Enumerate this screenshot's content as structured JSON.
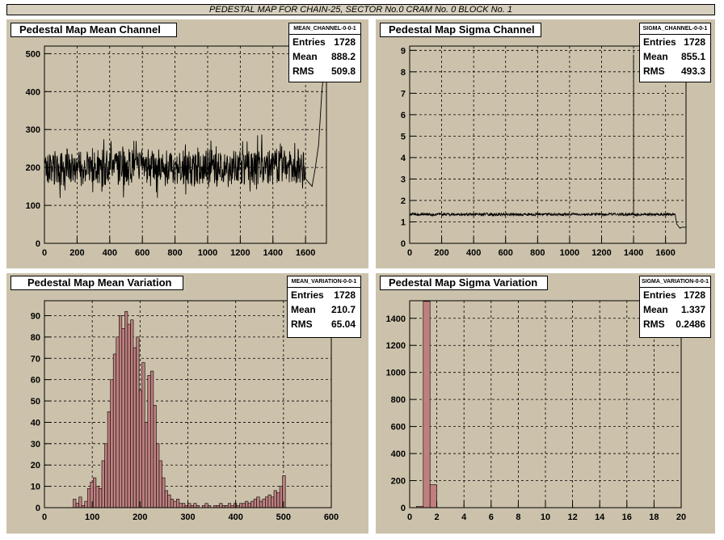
{
  "header": {
    "title": "PEDESTAL MAP FOR CHAIN-25, SECTOR No.0 CRAM No. 0 BLOCK No. 1"
  },
  "colors": {
    "panel_bg": "#ccc2ab",
    "hist_fill": "#bf7f7f",
    "frame": "#000000"
  },
  "chart_data": [
    {
      "type": "line",
      "title": "Pedestal Map Mean Channel",
      "xlim": [
        0,
        1728
      ],
      "ylim": [
        0,
        520
      ],
      "xticks": [
        0,
        200,
        400,
        600,
        800,
        1000,
        1200,
        1400,
        1600
      ],
      "yticks": [
        0,
        100,
        200,
        300,
        400,
        500
      ],
      "grid": true,
      "stats": {
        "name": "MEAN_CHANNEL-0-0-1",
        "entries": "1728",
        "mean": "888.2",
        "rms": "509.8"
      },
      "series": [
        {
          "baseline": 200,
          "noise": 45,
          "x": [
            1600,
            1640,
            1660,
            1680,
            1700,
            1728
          ],
          "y": [
            170,
            150,
            200,
            260,
            400,
            520
          ]
        }
      ]
    },
    {
      "type": "line",
      "title": "Pedestal Map Sigma Channel",
      "xlim": [
        0,
        1728
      ],
      "ylim": [
        0,
        9.2
      ],
      "xticks": [
        0,
        200,
        400,
        600,
        800,
        1000,
        1200,
        1400,
        1600
      ],
      "yticks": [
        0,
        1,
        2,
        3,
        4,
        5,
        6,
        7,
        8,
        9
      ],
      "grid": true,
      "stats": {
        "name": "SIGMA_CHANNEL-0-0-1",
        "entries": "1728",
        "mean": "855.1",
        "rms": "493.3"
      },
      "series": [
        {
          "baseline": 1.35,
          "noise": 0.06,
          "spike": {
            "x": 1400,
            "y": 8.8
          },
          "x": [
            1660,
            1670,
            1690,
            1700,
            1728
          ],
          "y": [
            1.35,
            0.9,
            0.7,
            0.75,
            0.75
          ]
        }
      ]
    },
    {
      "type": "bar",
      "title": "Pedestal Map Mean Variation",
      "xlim": [
        0,
        600
      ],
      "ylim": [
        0,
        97
      ],
      "xticks": [
        0,
        100,
        200,
        300,
        400,
        500,
        600
      ],
      "yticks": [
        0,
        10,
        20,
        30,
        40,
        50,
        60,
        70,
        80,
        90
      ],
      "grid": true,
      "bin_width": 6,
      "stats": {
        "name": "MEAN_VARIATION-0-0-1",
        "entries": "1728",
        "mean": "210.7",
        "rms": "65.04"
      },
      "bins_start": [
        60,
        66,
        72,
        78,
        84,
        90,
        96,
        102,
        108,
        114,
        120,
        126,
        132,
        138,
        144,
        150,
        156,
        162,
        168,
        174,
        180,
        186,
        192,
        198,
        204,
        210,
        216,
        222,
        228,
        234,
        240,
        246,
        252,
        258,
        264,
        270,
        276,
        282,
        288,
        294,
        300,
        306,
        312,
        318,
        324,
        330,
        336,
        342,
        348,
        354,
        360,
        366,
        372,
        378,
        384,
        390,
        396,
        402,
        408,
        414,
        420,
        426,
        432,
        438,
        444,
        450,
        456,
        462,
        468,
        474,
        480,
        486,
        492,
        498
      ],
      "values": [
        4,
        2,
        5,
        1,
        3,
        9,
        12,
        14,
        10,
        9,
        22,
        30,
        45,
        60,
        72,
        80,
        90,
        84,
        92,
        86,
        88,
        75,
        80,
        55,
        68,
        40,
        62,
        64,
        48,
        30,
        22,
        14,
        8,
        6,
        4,
        3,
        4,
        2,
        2,
        1,
        2,
        1,
        2,
        1,
        0,
        1,
        2,
        1,
        0,
        1,
        1,
        2,
        1,
        1,
        2,
        1,
        2,
        1,
        2,
        2,
        3,
        2,
        3,
        4,
        5,
        3,
        4,
        5,
        6,
        5,
        8,
        7,
        10,
        15
      ]
    },
    {
      "type": "bar",
      "title": "Pedestal Map Sigma Variation",
      "xlim": [
        0,
        20
      ],
      "ylim": [
        0,
        1530
      ],
      "xticks": [
        0,
        2,
        4,
        6,
        8,
        10,
        12,
        14,
        16,
        18,
        20
      ],
      "yticks": [
        0,
        200,
        400,
        600,
        800,
        1000,
        1200,
        1400
      ],
      "grid": true,
      "bin_width": 0.5,
      "stats": {
        "name": "SIGMA_VARIATION-0-0-1",
        "entries": "1728",
        "mean": "1.337",
        "rms": "0.2486"
      },
      "bins_start": [
        0.5,
        1.0,
        1.5
      ],
      "values": [
        10,
        1525,
        170
      ]
    }
  ]
}
